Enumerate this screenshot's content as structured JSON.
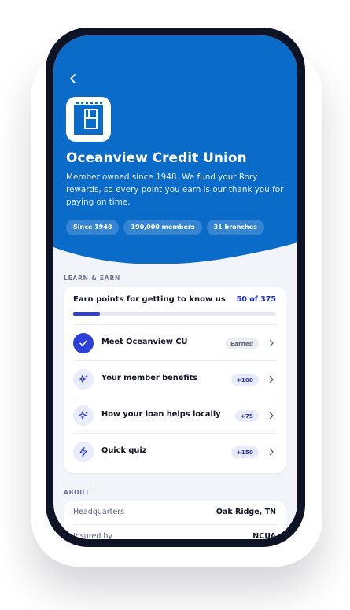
{
  "header": {
    "back_icon": "chevron-left-icon",
    "logo_icon": "credit-union-logo-icon",
    "title": "Oceanview Credit Union",
    "description": "Member owned since 1948. We fund your Rory rewards, so every point you earn is our thank you for paying on time.",
    "chips": [
      "Since 1948",
      "190,000 members",
      "31 branches"
    ]
  },
  "learn": {
    "section_label": "LEARN & EARN",
    "card_title": "Earn points for getting to know us",
    "progress_text": "50 of 375",
    "progress_fraction": 0.133,
    "tasks": [
      {
        "label": "Meet Oceanview CU",
        "badge": "Earned",
        "icon": "check-icon",
        "status": "earned"
      },
      {
        "label": "Your member benefits",
        "badge": "+100",
        "icon": "sparkle-icon",
        "status": "pending"
      },
      {
        "label": "How your loan helps locally",
        "badge": "+75",
        "icon": "sparkle-icon",
        "status": "pending"
      },
      {
        "label": "Quick quiz",
        "badge": "+150",
        "icon": "lightning-icon",
        "status": "pending"
      }
    ]
  },
  "about": {
    "section_label": "ABOUT",
    "rows": [
      {
        "key": "Headquarters",
        "value": "Oak Ridge, TN"
      },
      {
        "key": "Insured by",
        "value": "NCUA"
      }
    ]
  },
  "colors": {
    "brand_blue": "#0a6bc9",
    "accent": "#2c3fd8",
    "phone_frame": "#0e1326",
    "screen_bg": "#f2f4fa"
  }
}
